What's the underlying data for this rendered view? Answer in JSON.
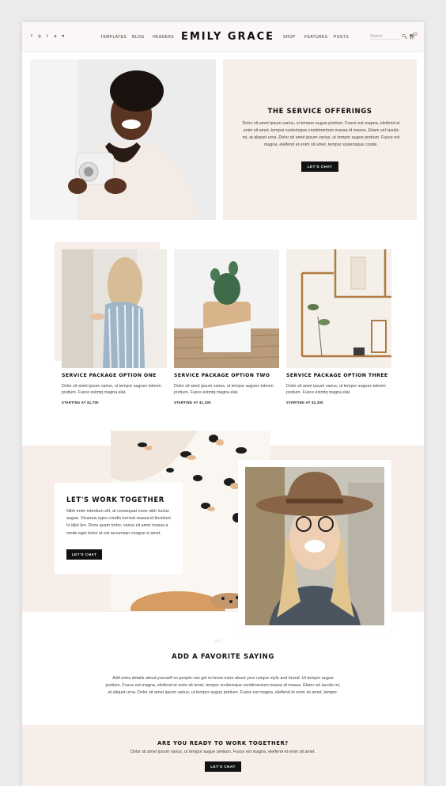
{
  "header": {
    "social_icons": [
      "facebook-icon",
      "instagram-icon",
      "twitter-icon",
      "pinterest-icon",
      "heart-icon"
    ],
    "social_glyphs": [
      "f",
      "◎",
      "t",
      "p",
      "♥"
    ],
    "nav_left": [
      "TEMPLATES",
      "BLOG",
      "HEADERS"
    ],
    "logo": "EMILY GRACE",
    "nav_right": [
      "SHOP",
      "FEATURES",
      "POSTS"
    ],
    "search_placeholder": "Search",
    "cart_count": "0"
  },
  "hero": {
    "title": "THE SERVICE OFFERINGS",
    "text": "Dolor sit amet ipsum varius, ut tempor augue pretium. Fusce est magna, eleifend et enim sit amet, tempor scelerisque condimentum massa id massa. Etiam vel iaculis mi, at aliquet urna. Dolor sit amet ipsum varius, ut tempor augue pretium. Fusce est magna, eleifend et enim sit amet, tempor scelerisque conde.",
    "button": "LET'S CHAT"
  },
  "packages": [
    {
      "title": "SERVICE PACKAGE OPTION ONE",
      "text": "Dolor sit amet ipsum varius, ut tempor augues tetenm pretium. Fusce estmtq magna elat.",
      "price": "STARTING AT $1,700"
    },
    {
      "title": "SERVICE PACKAGE OPTION TWO",
      "text": "Dolor sit amet ipsum varius, ut tempor augues tetenm pretium. Fusce estmtq magna elat.",
      "price": "STARTING AT $1,300"
    },
    {
      "title": "SERVICE PACKAGE OPTION THREE",
      "text": "Dolor sit amet ipsum varius, ut tempor augues tetenm pretium. Fusce estmtq magna elat.",
      "price": "STARTING AT $2,300"
    }
  ],
  "work": {
    "title": "LET'S WORK TOGETHER",
    "text": "Nibh enim interdum elit, at consequat nune nibh luctus augue. Vivamus eges condin turnest massa id tincidunt. In idjut leo. Dons quam tortor, varius sit amet massa a mode eget tortor ut est accumsan congue si amet.",
    "button": "LET'S CHAT"
  },
  "saying": {
    "title": "ADD A FAVORITE SAYING",
    "text": "Add extra details about yourself so people can get to know more about your unique style and brand. Ut tempor augue pretium. Fusce est magna, eleifend et enim sit amet, tempor scelerisque condimentum massa id massa. Etiam vel iaculis mi, at aliquet urna. Dolor sit amet ipsum varius, ut tempor augue pretium. Fusce est magna, eleifend et enim sit amet, tempor."
  },
  "cta": {
    "title": "ARE YOU READY TO WORK TOGETHER?",
    "text": "Dolor sit amet ipsum varius, ut tempor augue pretium. Fusce est magna, eleifend et enim sit amet.",
    "button": "LET'S CHAT"
  },
  "colors": {
    "blush": "#f7eeea",
    "dark": "#111111"
  }
}
